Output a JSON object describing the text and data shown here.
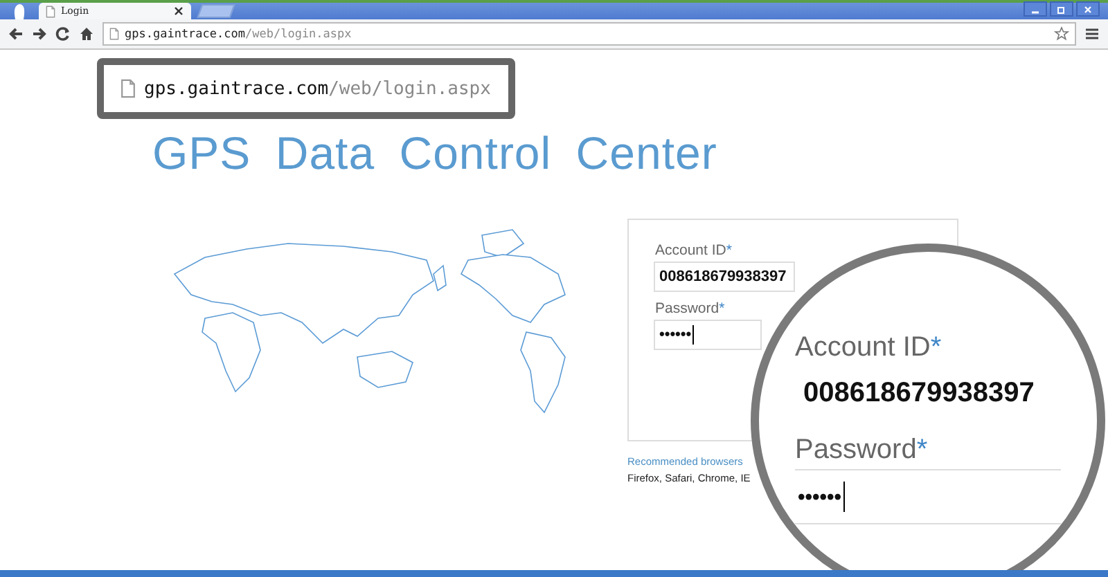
{
  "browser": {
    "tab": {
      "title": "Login"
    },
    "address": {
      "host": "gps.gaintrace.com",
      "path": "/web/login.aspx"
    }
  },
  "callout": {
    "host": "gps.gaintrace.com",
    "path": "/web/login.aspx"
  },
  "page": {
    "title": "GPS Data Control Center"
  },
  "login_form": {
    "fields": [
      {
        "label": "Account ID",
        "required_mark": "*",
        "value": "008618679938397"
      },
      {
        "label": "Password",
        "required_mark": "*",
        "value": "••••••",
        "focused": true
      }
    ]
  },
  "browsers_note": {
    "heading": "Recommended browsers",
    "list": "Firefox, Safari, Chrome, IE"
  },
  "magnifier": {
    "fields": [
      {
        "label": "Account ID",
        "required_mark": "*",
        "value": "008618679938397"
      },
      {
        "label": "Password",
        "required_mark": "*",
        "value": "••••••",
        "focused": true
      }
    ]
  }
}
